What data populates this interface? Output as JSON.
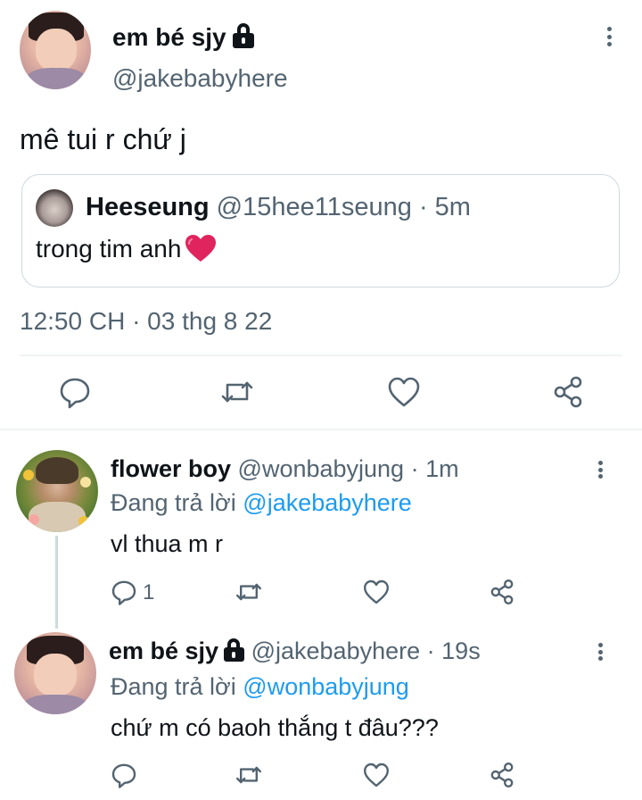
{
  "main_tweet": {
    "display_name": "em bé sjy",
    "handle": "@jakebabyhere",
    "text": "mê tui r chứ j",
    "quote": {
      "display_name": "Heeseung",
      "handle": "@15hee11seung",
      "separator": "·",
      "time": "5m",
      "text": "trong tim anh",
      "emoji": "heart"
    },
    "timestamp": "12:50 CH · 03 thg 8 22"
  },
  "replies": [
    {
      "display_name": "flower boy",
      "handle": "@wonbabyjung",
      "separator": "·",
      "time": "1m",
      "replying_prefix": "Đang trả lời",
      "replying_to": "@jakebabyhere",
      "text": "vl thua m r",
      "reply_count": "1"
    },
    {
      "display_name": "em bé sjy",
      "handle": "@jakebabyhere",
      "separator": "·",
      "time": "19s",
      "replying_prefix": "Đang trả lời",
      "replying_to": "@wonbabyjung",
      "text": "chứ m có baoh thắng t đâu???"
    }
  ],
  "icons": {
    "reply": "reply-icon",
    "retweet": "retweet-icon",
    "like": "like-icon",
    "share": "share-icon",
    "more": "more-icon",
    "lock": "lock-icon"
  },
  "colors": {
    "text": "#0f1419",
    "secondary": "#536471",
    "link": "#1d9bf0",
    "border": "#cfd9de",
    "heart": "#e0245e"
  }
}
